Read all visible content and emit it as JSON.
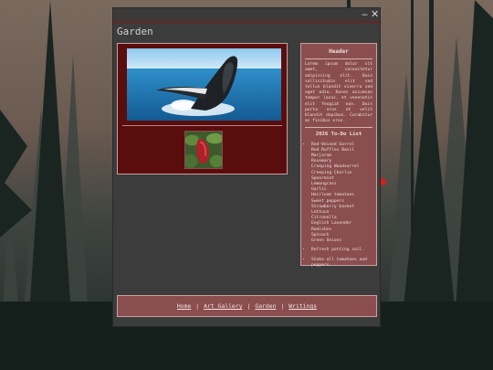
{
  "window": {
    "minimize_label": "‒",
    "close_label": "✕"
  },
  "page": {
    "title": "Garden"
  },
  "gallery": {
    "main_photo": "whale-breaching-photo",
    "thumb_photo": "red-pepper-plant-photo"
  },
  "sidebar": {
    "header": "Header",
    "lorem": "Lorem ipsum dolor sit amet, consectetur adipiscing elit. Duis sollicitudin elit sed tellus blandit viverra sed eget odio. Donec accumsan tempor lacus, et venenatis elit feugiat non. Duis porta eros et velit blandit dapibus. Curabitur ac finibus eros.",
    "todo_title": "2026 To-Do List",
    "plants": [
      "Red-Veined Sorrel",
      "Red Ruffles Basil",
      "Marjoram",
      "Rosemary",
      "Creeping Woodsorrel",
      "Creeping Charlie",
      "Spearmint",
      "Lemongrass",
      "Garlic",
      "Heirloom tomatoes",
      "Sweet peppers",
      "Strawberry basket",
      "Lettuce",
      "Citronella",
      "English Lavender",
      "Radishes",
      "Spinach",
      "Green Onions"
    ],
    "tasks": [
      "Refresh potting soil.",
      "Stake all tomatoes and peppers."
    ]
  },
  "nav": {
    "home": "Home",
    "art_gallery": "Art Gallery",
    "garden": "Garden",
    "writings": "Writings",
    "separator": "|"
  },
  "colors": {
    "accent": "#6b2424",
    "panel": "#8a4e4e",
    "gallery_bg": "#5a0d0d"
  }
}
